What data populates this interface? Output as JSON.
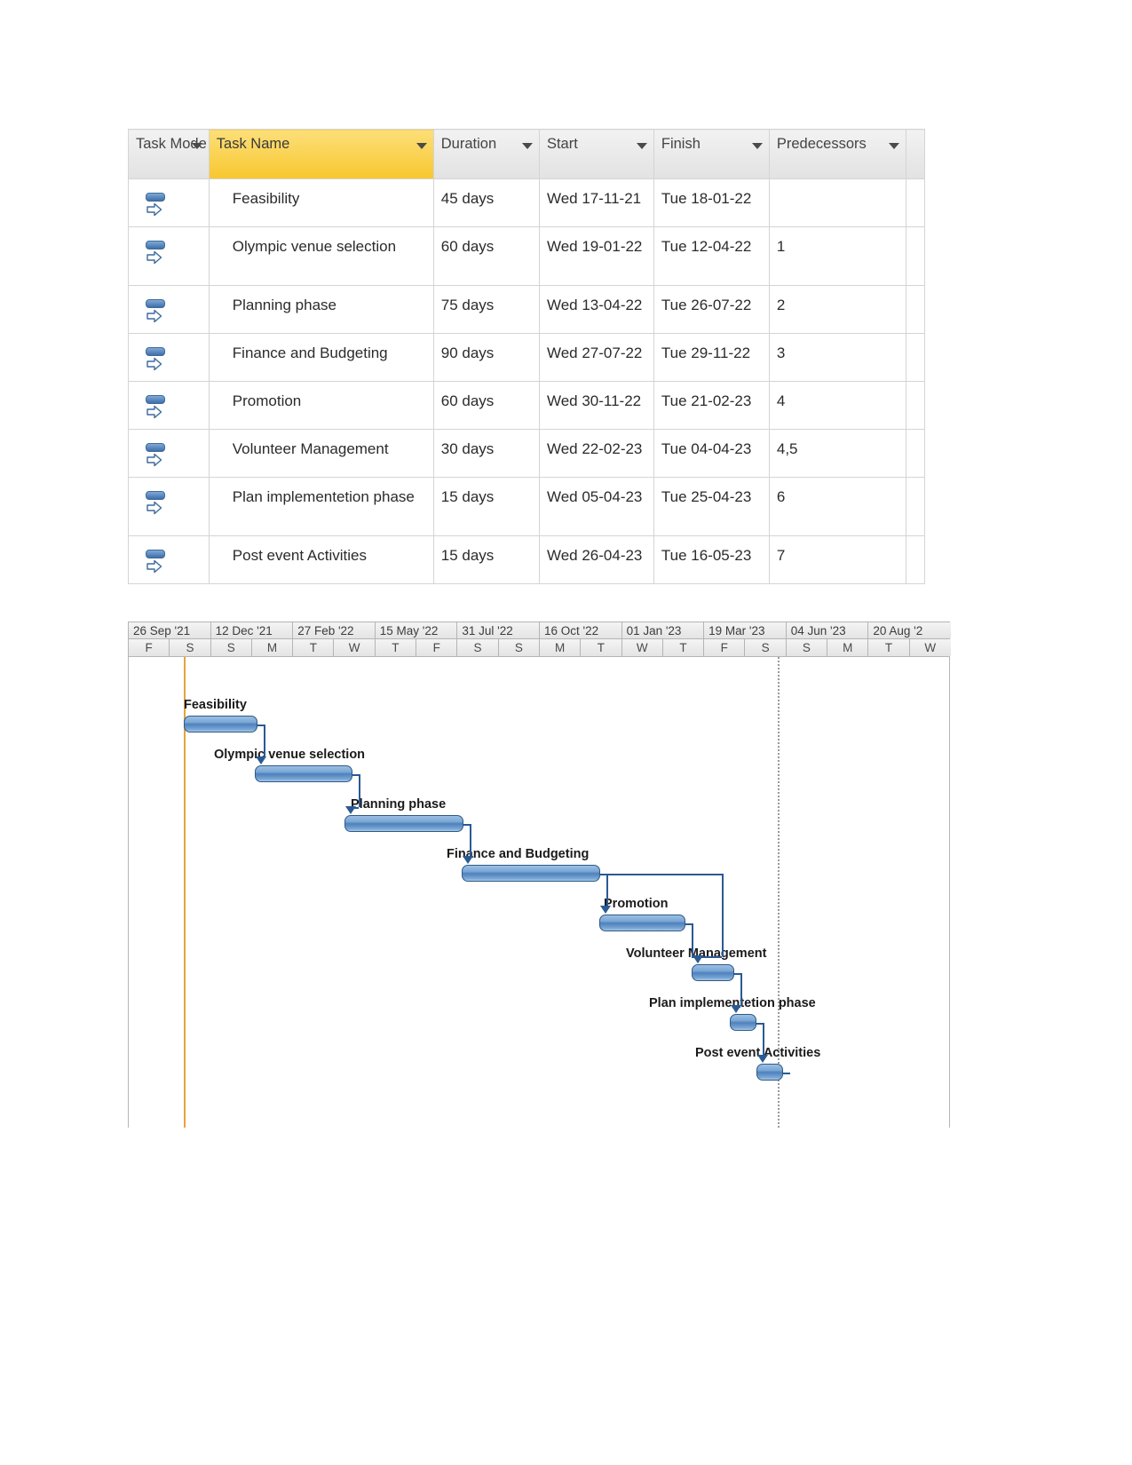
{
  "table": {
    "columns": [
      {
        "key": "mode",
        "label": "Task Mode",
        "filter": true,
        "highlight": false
      },
      {
        "key": "name",
        "label": "Task Name",
        "filter": true,
        "highlight": true
      },
      {
        "key": "duration",
        "label": "Duration",
        "filter": true,
        "highlight": false
      },
      {
        "key": "start",
        "label": "Start",
        "filter": true,
        "highlight": false
      },
      {
        "key": "finish",
        "label": "Finish",
        "filter": true,
        "highlight": false
      },
      {
        "key": "predecessors",
        "label": "Predecessors",
        "filter": true,
        "highlight": false
      }
    ],
    "rows": [
      {
        "mode_icon": "auto-scheduled-icon",
        "name": "Feasibility",
        "duration": "45 days",
        "start": "Wed 17-11-21",
        "finish": "Tue 18-01-22",
        "predecessors": ""
      },
      {
        "mode_icon": "auto-scheduled-icon",
        "name": "Olympic venue selection",
        "duration": "60 days",
        "start": "Wed 19-01-22",
        "finish": "Tue 12-04-22",
        "predecessors": "1"
      },
      {
        "mode_icon": "auto-scheduled-icon",
        "name": "Planning phase",
        "duration": "75 days",
        "start": "Wed 13-04-22",
        "finish": "Tue 26-07-22",
        "predecessors": "2"
      },
      {
        "mode_icon": "auto-scheduled-icon",
        "name": "Finance and Budgeting",
        "duration": "90 days",
        "start": "Wed 27-07-22",
        "finish": "Tue 29-11-22",
        "predecessors": "3"
      },
      {
        "mode_icon": "auto-scheduled-icon",
        "name": "Promotion",
        "duration": "60 days",
        "start": "Wed 30-11-22",
        "finish": "Tue 21-02-23",
        "predecessors": "4"
      },
      {
        "mode_icon": "auto-scheduled-icon",
        "name": "Volunteer Management",
        "duration": "30 days",
        "start": "Wed 22-02-23",
        "finish": "Tue 04-04-23",
        "predecessors": "4,5"
      },
      {
        "mode_icon": "auto-scheduled-icon",
        "name": "Plan implementetion phase",
        "duration": "15 days",
        "start": "Wed 05-04-23",
        "finish": "Tue 25-04-23",
        "predecessors": "6"
      },
      {
        "mode_icon": "auto-scheduled-icon",
        "name": "Post event Activities",
        "duration": "15 days",
        "start": "Wed 26-04-23",
        "finish": "Tue 16-05-23",
        "predecessors": "7"
      }
    ]
  },
  "gantt": {
    "timeline_periods": [
      "26 Sep '21",
      "12 Dec '21",
      "27 Feb '22",
      "15 May '22",
      "31 Jul '22",
      "16 Oct '22",
      "01 Jan '23",
      "19 Mar '23",
      "04 Jun '23",
      "20 Aug '2"
    ],
    "day_letters": [
      "F",
      "S",
      "S",
      "M",
      "T",
      "W",
      "T",
      "F",
      "S",
      "S",
      "M",
      "T",
      "W",
      "T",
      "F",
      "S",
      "S",
      "M",
      "T",
      "W"
    ],
    "bars": [
      {
        "label": "Feasibility",
        "duration": "45 days"
      },
      {
        "label": "Olympic venue selection",
        "duration": "60 days"
      },
      {
        "label": "Planning phase",
        "duration": "75 days"
      },
      {
        "label": "Finance and Budgeting",
        "duration": "90 days"
      },
      {
        "label": "Promotion",
        "duration": "60 days"
      },
      {
        "label": "Volunteer Management",
        "duration": "30 days"
      },
      {
        "label": "Plan implementetion phase",
        "duration": "15 days"
      },
      {
        "label": "Post event Activities",
        "duration": "15 days"
      }
    ]
  },
  "colors": {
    "header_highlight": "#fbd34d",
    "bar_fill": "#4f81bd",
    "bar_border": "#2f5986",
    "project_start_line": "#e8a33d",
    "today_line": "#9a9a9a"
  },
  "chart_data": {
    "type": "bar",
    "title": "",
    "xlabel": "",
    "ylabel": "",
    "categories": [
      "Feasibility",
      "Olympic venue selection",
      "Planning phase",
      "Finance and Budgeting",
      "Promotion",
      "Volunteer Management",
      "Plan implementetion phase",
      "Post event Activities"
    ],
    "series": [
      {
        "name": "Duration (days)",
        "values": [
          45,
          60,
          75,
          90,
          60,
          30,
          15,
          15
        ]
      }
    ],
    "tasks": [
      {
        "name": "Feasibility",
        "start": "Wed 17-11-21",
        "finish": "Tue 18-01-22",
        "duration_days": 45,
        "predecessors": []
      },
      {
        "name": "Olympic venue selection",
        "start": "Wed 19-01-22",
        "finish": "Tue 12-04-22",
        "duration_days": 60,
        "predecessors": [
          1
        ]
      },
      {
        "name": "Planning phase",
        "start": "Wed 13-04-22",
        "finish": "Tue 26-07-22",
        "duration_days": 75,
        "predecessors": [
          2
        ]
      },
      {
        "name": "Finance and Budgeting",
        "start": "Wed 27-07-22",
        "finish": "Tue 29-11-22",
        "duration_days": 90,
        "predecessors": [
          3
        ]
      },
      {
        "name": "Promotion",
        "start": "Wed 30-11-22",
        "finish": "Tue 21-02-23",
        "duration_days": 60,
        "predecessors": [
          4
        ]
      },
      {
        "name": "Volunteer Management",
        "start": "Wed 22-02-23",
        "finish": "Tue 04-04-23",
        "duration_days": 30,
        "predecessors": [
          4,
          5
        ]
      },
      {
        "name": "Plan implementetion phase",
        "start": "Wed 05-04-23",
        "finish": "Tue 25-04-23",
        "duration_days": 15,
        "predecessors": [
          6
        ]
      },
      {
        "name": "Post event Activities",
        "start": "Wed 26-04-23",
        "finish": "Tue 16-05-23",
        "duration_days": 15,
        "predecessors": [
          7
        ]
      }
    ],
    "axis_ticks": [
      "26 Sep '21",
      "12 Dec '21",
      "27 Feb '22",
      "15 May '22",
      "31 Jul '22",
      "16 Oct '22",
      "01 Jan '23",
      "19 Mar '23",
      "04 Jun '23",
      "20 Aug '2"
    ],
    "grid": false,
    "legend": "none"
  }
}
